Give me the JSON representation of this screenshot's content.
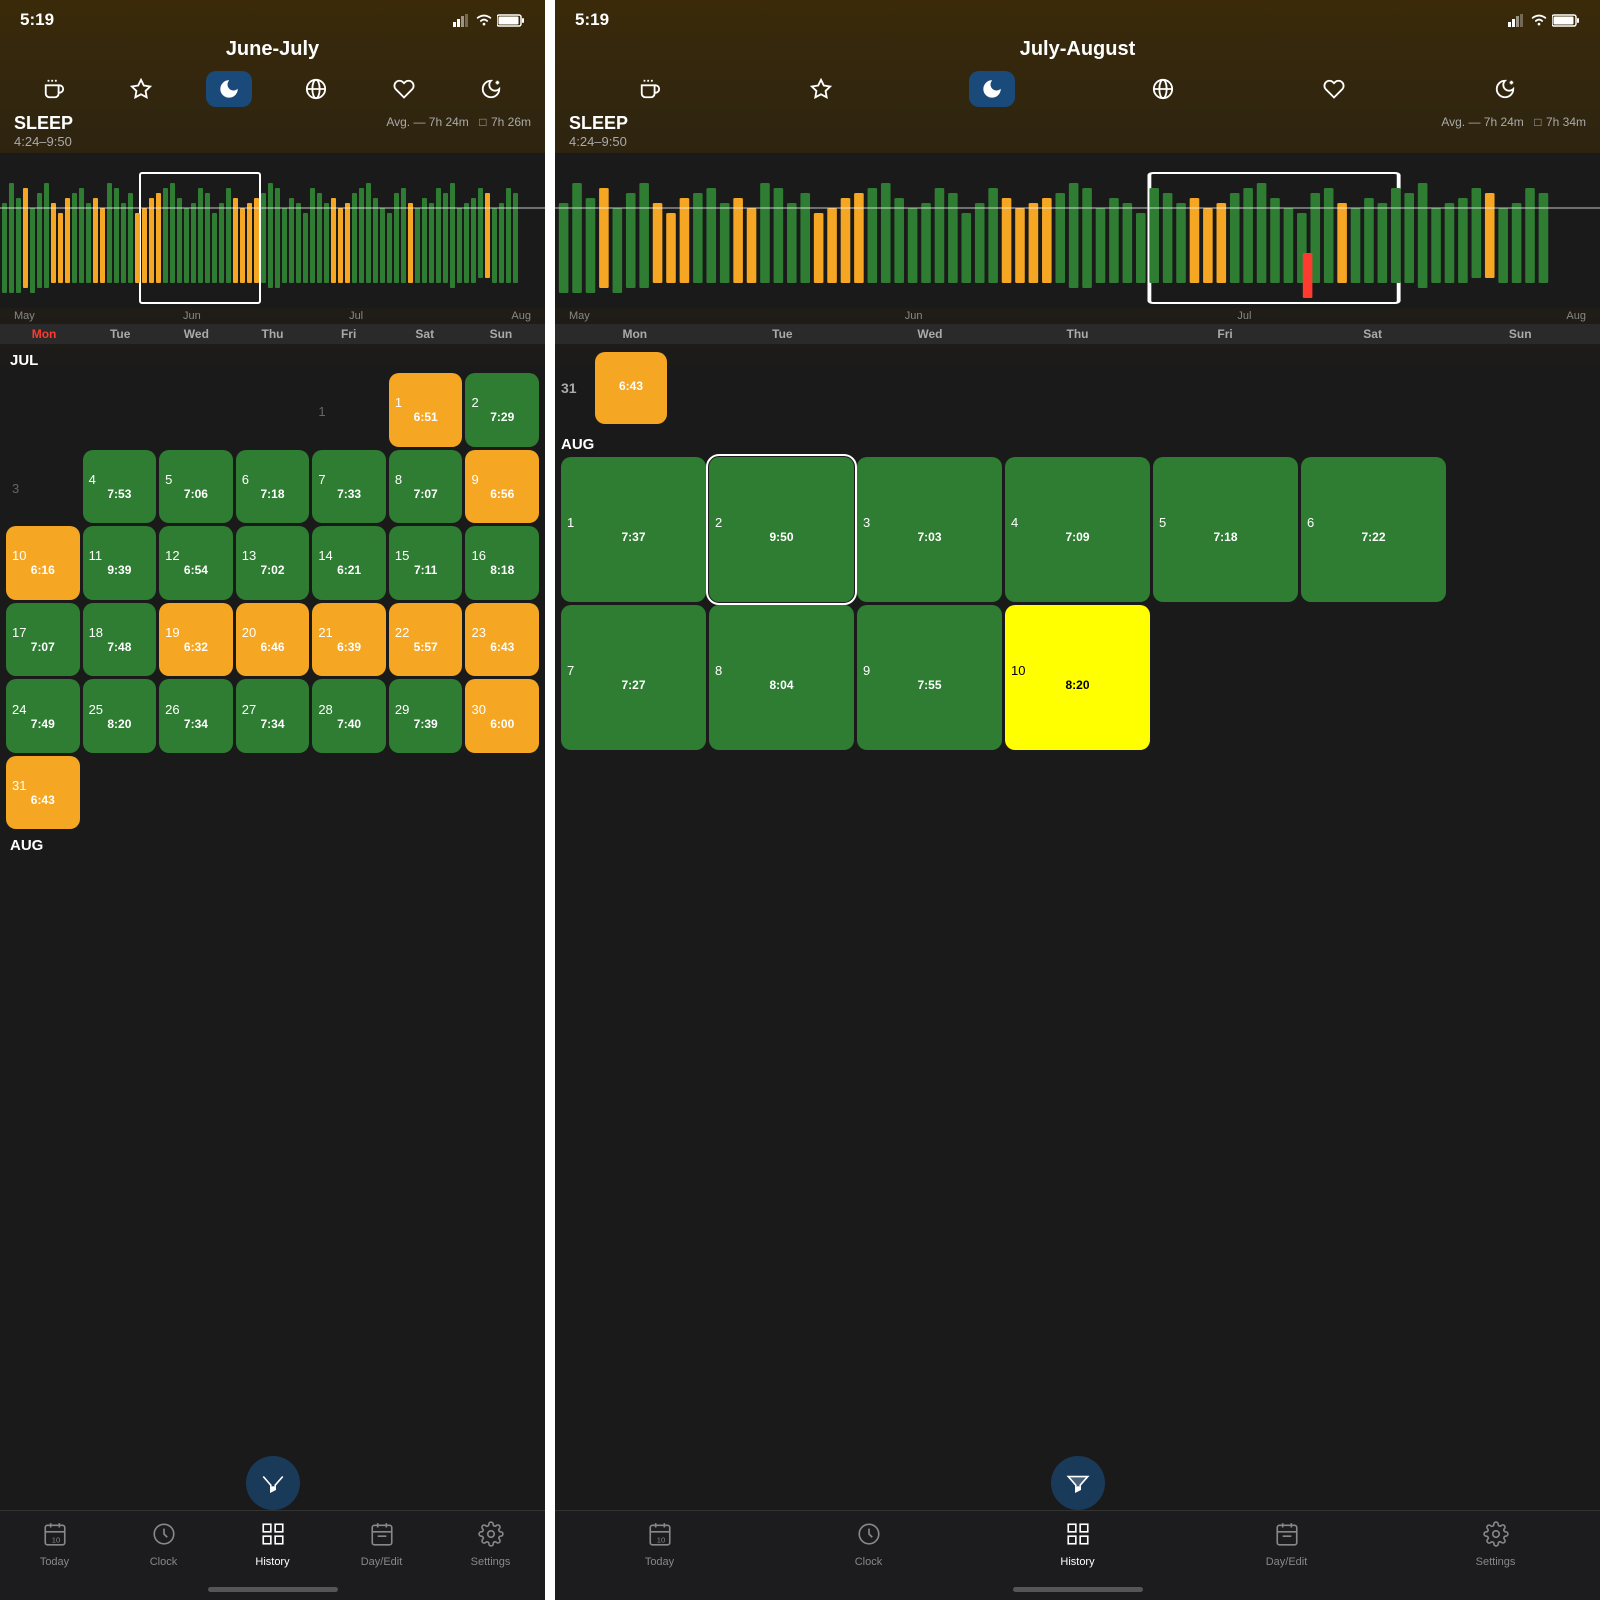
{
  "phone1": {
    "status": {
      "time": "5:19",
      "person_icon": "👤",
      "signal": "▂▄▆",
      "wifi": "wifi",
      "battery": "battery"
    },
    "title": "June-July",
    "tab_icons": [
      "coffee-icon",
      "star-icon",
      "moon-icon",
      "globe-icon",
      "heart-icon",
      "zzz-icon"
    ],
    "active_tab_icon": 2,
    "sleep_label": "SLEEP",
    "sleep_time": "4:24–9:50",
    "avg_label": "Avg. — 7h 24m",
    "avg_box": "7h 26m",
    "chart_month_labels": [
      "May",
      "Jun",
      "Jul",
      "Aug"
    ],
    "dow_labels": [
      "Mon",
      "Tue",
      "Wed",
      "Thu",
      "Fri",
      "Sat",
      "Sun"
    ],
    "dow_highlight_index": 0,
    "months": [
      {
        "label": "JUL",
        "weeks": [
          [
            {
              "date": "",
              "time": "",
              "color": "empty"
            },
            {
              "date": "",
              "time": "",
              "color": "empty"
            },
            {
              "date": "",
              "time": "",
              "color": "empty"
            },
            {
              "date": "",
              "time": "",
              "color": "empty"
            },
            {
              "date": "1",
              "time": "",
              "color": "empty"
            },
            {
              "date": "2",
              "time": "",
              "color": "empty"
            },
            {
              "date": "",
              "time": "",
              "color": "empty"
            }
          ],
          [
            {
              "date": "",
              "time": "",
              "color": "empty"
            },
            {
              "date": "",
              "time": "",
              "color": "empty"
            },
            {
              "date": "",
              "time": "",
              "color": "empty"
            },
            {
              "date": "",
              "time": "",
              "color": "empty"
            },
            {
              "date": "1",
              "time": "",
              "color": "empty"
            },
            {
              "date": "1",
              "time": "6:51",
              "color": "yellow"
            },
            {
              "date": "2",
              "time": "7:29",
              "color": "green"
            }
          ],
          [
            {
              "date": "3",
              "time": "",
              "color": "empty"
            },
            {
              "date": "4",
              "time": "7:53",
              "color": "green"
            },
            {
              "date": "5",
              "time": "7:06",
              "color": "green"
            },
            {
              "date": "6",
              "time": "7:18",
              "color": "green"
            },
            {
              "date": "7",
              "time": "7:33",
              "color": "green"
            },
            {
              "date": "8",
              "time": "7:07",
              "color": "green"
            },
            {
              "date": "9",
              "time": "6:56",
              "color": "yellow"
            }
          ],
          [
            {
              "date": "10",
              "time": "6:16",
              "color": "yellow"
            },
            {
              "date": "11",
              "time": "9:39",
              "color": "green"
            },
            {
              "date": "12",
              "time": "6:54",
              "color": "green"
            },
            {
              "date": "13",
              "time": "7:02",
              "color": "green"
            },
            {
              "date": "14",
              "time": "6:21",
              "color": "green"
            },
            {
              "date": "15",
              "time": "7:11",
              "color": "green"
            },
            {
              "date": "16",
              "time": "8:18",
              "color": "green"
            }
          ],
          [
            {
              "date": "17",
              "time": "7:07",
              "color": "green"
            },
            {
              "date": "18",
              "time": "7:48",
              "color": "green"
            },
            {
              "date": "19",
              "time": "6:32",
              "color": "yellow"
            },
            {
              "date": "20",
              "time": "6:46",
              "color": "yellow"
            },
            {
              "date": "21",
              "time": "6:39",
              "color": "yellow"
            },
            {
              "date": "22",
              "time": "5:57",
              "color": "yellow"
            },
            {
              "date": "23",
              "time": "6:43",
              "color": "yellow"
            }
          ],
          [
            {
              "date": "24",
              "time": "7:49",
              "color": "green"
            },
            {
              "date": "25",
              "time": "8:20",
              "color": "green"
            },
            {
              "date": "26",
              "time": "7:34",
              "color": "green"
            },
            {
              "date": "27",
              "time": "7:34",
              "color": "green"
            },
            {
              "date": "28",
              "time": "7:40",
              "color": "green"
            },
            {
              "date": "29",
              "time": "7:39",
              "color": "green"
            },
            {
              "date": "30",
              "time": "6:00",
              "color": "yellow"
            }
          ],
          [
            {
              "date": "31",
              "time": "6:43",
              "color": "yellow"
            },
            {
              "date": "",
              "time": "",
              "color": "empty"
            },
            {
              "date": "",
              "time": "",
              "color": "empty"
            },
            {
              "date": "",
              "time": "",
              "color": "empty"
            },
            {
              "date": "",
              "time": "",
              "color": "empty"
            },
            {
              "date": "",
              "time": "",
              "color": "empty"
            },
            {
              "date": "",
              "time": "",
              "color": "empty"
            }
          ]
        ]
      }
    ],
    "tab_bar": [
      {
        "label": "Today",
        "icon": "📅",
        "active": false
      },
      {
        "label": "Clock",
        "icon": "⏰",
        "active": false
      },
      {
        "label": "History",
        "icon": "⊞",
        "active": true
      },
      {
        "label": "Day/Edit",
        "icon": "📋",
        "active": false
      },
      {
        "label": "Settings",
        "icon": "⚙️",
        "active": false
      }
    ]
  },
  "phone2": {
    "status": {
      "time": "5:19",
      "person_icon": "👤"
    },
    "title": "July-August",
    "sleep_label": "SLEEP",
    "sleep_time": "4:24–9:50",
    "avg_label": "Avg. — 7h 24m",
    "avg_box": "7h 34m",
    "chart_month_labels": [
      "May",
      "Jun",
      "Jul",
      "Aug"
    ],
    "dow_labels": [
      "Mon",
      "Tue",
      "Wed",
      "Thu",
      "Fri",
      "Sat",
      "Sun"
    ],
    "months": [
      {
        "label": "31",
        "is_single": true,
        "cells": [
          {
            "date": "31",
            "time": "6:43",
            "color": "yellow",
            "col": 1
          }
        ]
      },
      {
        "label": "AUG",
        "weeks": [
          [
            {
              "date": "1",
              "time": "7:37",
              "color": "green"
            },
            {
              "date": "2",
              "time": "9:50",
              "color": "green",
              "selected": true
            },
            {
              "date": "3",
              "time": "7:03",
              "color": "green"
            },
            {
              "date": "4",
              "time": "7:09",
              "color": "green"
            },
            {
              "date": "5",
              "time": "7:18",
              "color": "green"
            },
            {
              "date": "6",
              "time": "7:22",
              "color": "green"
            },
            {
              "date": "",
              "time": "",
              "color": "empty"
            }
          ],
          [
            {
              "date": "7",
              "time": "7:27",
              "color": "green"
            },
            {
              "date": "8",
              "time": "8:04",
              "color": "green"
            },
            {
              "date": "9",
              "time": "7:55",
              "color": "green"
            },
            {
              "date": "10",
              "time": "8:20",
              "color": "green",
              "today": true
            },
            {
              "date": "",
              "time": "",
              "color": "empty"
            },
            {
              "date": "",
              "time": "",
              "color": "empty"
            },
            {
              "date": "",
              "time": "",
              "color": "empty"
            }
          ]
        ]
      }
    ],
    "tab_bar": [
      {
        "label": "Today",
        "icon": "📅",
        "active": false
      },
      {
        "label": "Clock",
        "icon": "⏰",
        "active": false
      },
      {
        "label": "History",
        "icon": "⊞",
        "active": true
      },
      {
        "label": "Day/Edit",
        "icon": "📋",
        "active": false
      },
      {
        "label": "Settings",
        "icon": "⚙️",
        "active": false
      }
    ]
  }
}
